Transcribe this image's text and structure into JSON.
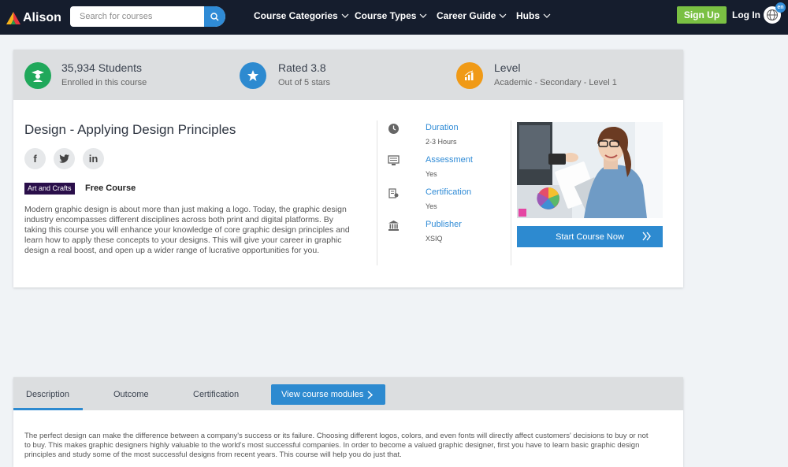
{
  "nav": {
    "logo_text": "Alison",
    "search_placeholder": "Search for courses",
    "menu": [
      "Course Categories",
      "Course Types",
      "Career Guide",
      "Hubs"
    ],
    "signup": "Sign Up",
    "login": "Log In",
    "language": "en"
  },
  "stats": [
    {
      "title": "35,934 Students",
      "sub": "Enrolled in this course",
      "icon": "graduate-icon",
      "color": "#20a85b"
    },
    {
      "title": "Rated 3.8",
      "sub": "Out of 5 stars",
      "icon": "star-icon",
      "color": "#2d8ad0"
    },
    {
      "title": "Level",
      "sub": "Academic - Secondary - Level 1",
      "icon": "bar-chart-icon",
      "color": "#f09a17"
    }
  ],
  "course": {
    "title": "Design - Applying Design Principles",
    "social": [
      "f",
      "twitter",
      "in"
    ],
    "tag": "Art and Crafts",
    "price_label": "Free Course",
    "description": "Modern graphic design is about more than just making a logo. Today, the graphic design industry encompasses different disciplines across both print and digital platforms. By taking this course you will enhance your knowledge of core graphic design principles and learn how to apply these concepts to your designs. This will give your career in graphic design a real boost, and open up a wider range of lucrative opportunities for you."
  },
  "info": [
    {
      "label": "Duration",
      "value": "2-3 Hours",
      "icon": "clock-icon"
    },
    {
      "label": "Assessment",
      "value": "Yes",
      "icon": "assessment-icon"
    },
    {
      "label": "Certification",
      "value": "Yes",
      "icon": "certificate-icon"
    },
    {
      "label": "Publisher",
      "value": "XSIQ",
      "icon": "bank-icon"
    }
  ],
  "cta": {
    "start": "Start Course Now"
  },
  "tabs": {
    "items": [
      "Description",
      "Outcome",
      "Certification"
    ],
    "modules_button": "View course modules",
    "active": "Description",
    "text": "The perfect design can make the difference between a company's success or its failure. Choosing different logos, colors, and even fonts will directly affect customers' decisions to buy or not to buy. This makes graphic designers highly valuable to the world's most successful companies. In order to become a valued graphic designer, first you have to learn basic graphic design principles and study some of the most successful designs from recent years. This course will help you do just that."
  }
}
